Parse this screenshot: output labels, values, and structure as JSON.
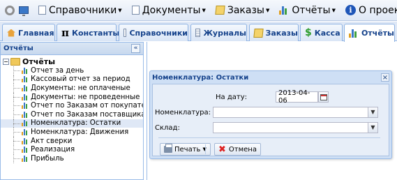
{
  "menu": {
    "items": [
      {
        "label": "Справочники",
        "icon": "document-icon",
        "has_arrow": true
      },
      {
        "label": "Документы",
        "icon": "document-icon",
        "has_arrow": true
      },
      {
        "label": "Заказы",
        "icon": "notepad-icon",
        "has_arrow": true
      },
      {
        "label": "Отчёты",
        "icon": "bar-chart-icon",
        "has_arrow": true
      },
      {
        "label": "О проекте",
        "icon": "info-icon",
        "has_arrow": false
      }
    ]
  },
  "tabs": [
    {
      "label": "Главная",
      "icon": "home-icon"
    },
    {
      "label": "Константы",
      "icon": "pi-icon"
    },
    {
      "label": "Справочники",
      "icon": "book-icon"
    },
    {
      "label": "Журналы",
      "icon": "journal-icon"
    },
    {
      "label": "Заказы",
      "icon": "notepad-icon"
    },
    {
      "label": "Касса",
      "icon": "dollar-icon"
    },
    {
      "label": "Отчёты",
      "icon": "bar-chart-icon",
      "active": true
    }
  ],
  "sidebar": {
    "title": "Отчёты",
    "collapse_glyph": "«",
    "root": {
      "expander": "−",
      "label": "Отчёты"
    },
    "items": [
      {
        "label": "Отчет за день"
      },
      {
        "label": "Кассовый отчет за период"
      },
      {
        "label": "Документы: не оплаченые"
      },
      {
        "label": "Документы: не проведенные"
      },
      {
        "label": "Отчет по Заказам от покупател..."
      },
      {
        "label": "Отчет по Заказам поставщикам"
      },
      {
        "label": "Номенклатура: Остатки",
        "selected": true
      },
      {
        "label": "Номенклатура: Движения"
      },
      {
        "label": "Акт сверки"
      },
      {
        "label": "Реализация"
      },
      {
        "label": "Прибыль"
      }
    ]
  },
  "dialog": {
    "title": "Номенклатура: Остатки",
    "close_glyph": "×",
    "date_label": "На дату:",
    "date_value": "2013-04-06",
    "nomenclature_label": "Номенклатура:",
    "nomenclature_value": "",
    "warehouse_label": "Склад:",
    "warehouse_value": "",
    "print_label": "Печать",
    "cancel_label": "Отмена"
  },
  "colors": {
    "accent": "#15428b",
    "panel_border": "#99bbe8",
    "selected_row": "#dfe8f6"
  }
}
